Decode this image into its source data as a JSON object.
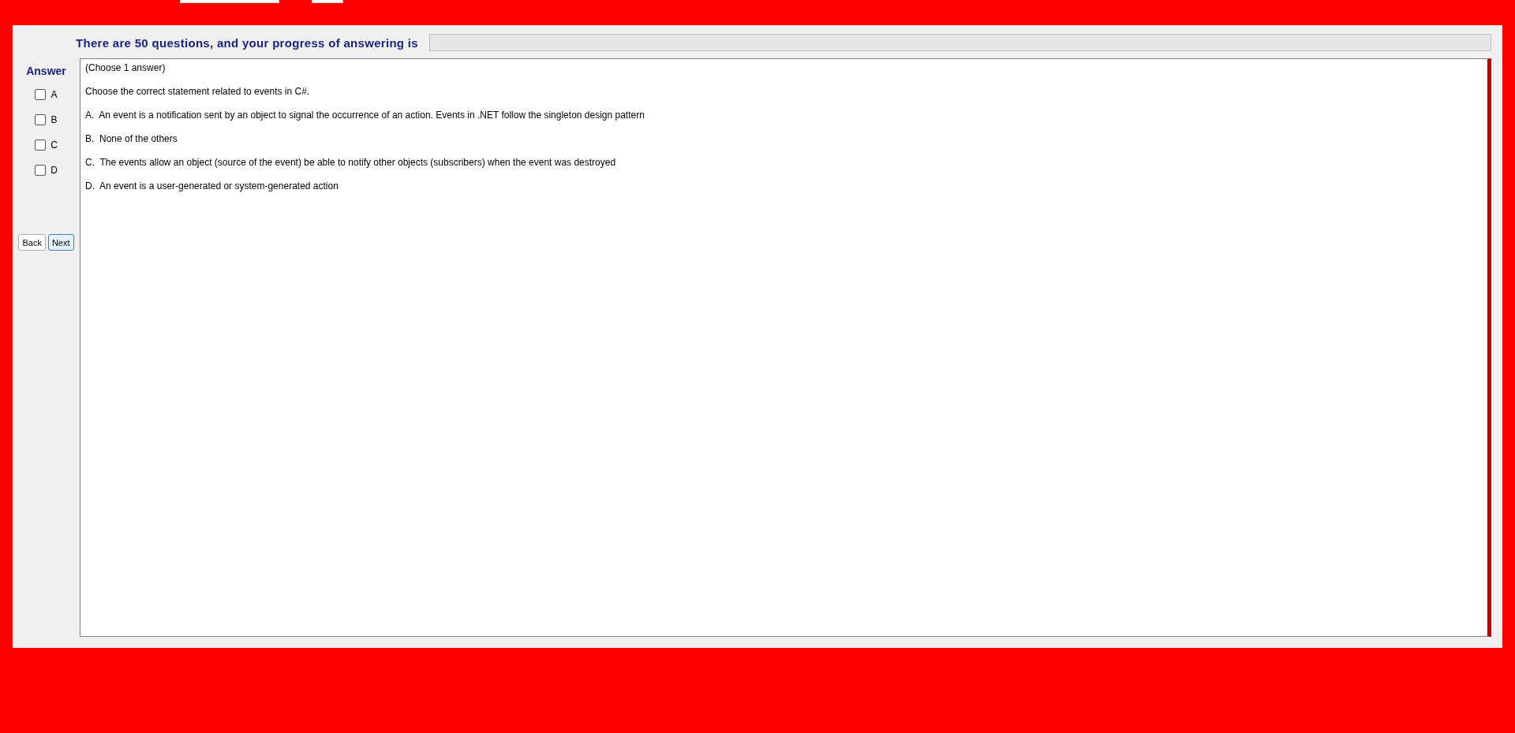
{
  "header": {
    "progress_label": "There are 50 questions, and your progress of answering is",
    "progress": {
      "level": 0
    }
  },
  "answer_panel": {
    "title": "Answer",
    "options": [
      {
        "label": "A",
        "checked": false
      },
      {
        "label": "B",
        "checked": false
      },
      {
        "label": "C",
        "checked": false
      },
      {
        "label": "D",
        "checked": false
      }
    ]
  },
  "buttons": [
    {
      "label": "Back",
      "focused": false
    },
    {
      "label": "Next",
      "focused": true
    }
  ],
  "question": {
    "instruction": "(Choose 1 answer)",
    "text": "Choose the correct statement related to events in C#.",
    "choices": [
      "A.  An event is a notification sent by an object to signal the occurrence of an action. Events in .NET follow the singleton design pattern",
      "B.  None of the others",
      "C.  The events allow an object (source of the event) be able to notify other objects (subscribers) when the event was destroyed",
      "D.  An event is a user-generated or system-generated action"
    ]
  }
}
